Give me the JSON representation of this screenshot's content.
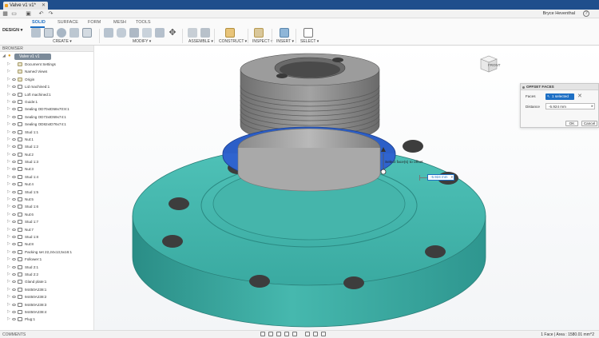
{
  "window": {
    "tab_title": "Valve v1 v1*"
  },
  "quick_access": {
    "user_name": "Bryce Heventhal"
  },
  "ribbon": {
    "workspace": "DESIGN ▾",
    "tabs": [
      "SOLID",
      "SURFACE",
      "FORM",
      "MESH",
      "TOOLS"
    ],
    "active_tab": "SOLID",
    "groups": [
      "CREATE ▾",
      "MODIFY ▾",
      "ASSEMBLE ▾",
      "CONSTRUCT ▾",
      "INSPECT ▾",
      "INSERT ▾",
      "SELECT ▾"
    ]
  },
  "browser": {
    "header": "BROWSER",
    "root_label": "Valve v1 v1",
    "items": [
      "Document Settings",
      "Named Views",
      "Origin",
      "Lid machined:1",
      "Loft machined:1",
      "Guide:1",
      "Sealing OD70xID58x70:8:1",
      "Sealing OD73xID59x74:1",
      "Sealing OD82xID76x74:1",
      "Stud 1:1",
      "Nut:1",
      "Stud 1:2",
      "Nut:2",
      "Stud 1:3",
      "Nut:3",
      "Stud 1:4",
      "Nut:4",
      "Stud 1:5",
      "Nut:5",
      "Stud 1:6",
      "Nut:6",
      "Stud 1:7",
      "Nut:7",
      "Stud 1:8",
      "Nut:8",
      "Packing set 22,24x13,5x16:1",
      "Follower:1",
      "Stud 2:1",
      "Stud 2:2",
      "Gland plate:1",
      "94450A238:1",
      "94450A238:2",
      "94450A238:3",
      "94450A238:4",
      "Plug:1"
    ]
  },
  "dialog": {
    "title": "OFFSET FACES",
    "faces_label": "Faces",
    "faces_value": "1 selected",
    "distance_label": "Distance",
    "distance_value": "-5.924 mm",
    "ok_label": "OK",
    "cancel_label": "Cancel"
  },
  "viewport": {
    "tooltip": "Select face(s) to offset",
    "dimension_value": "-5.924 mm",
    "viewcube_label": "FRONT"
  },
  "status": {
    "comments_label": "COMMENTS",
    "selection_info": "1 Face | Area : 1580.01 mm^2"
  },
  "colors": {
    "model_teal": "#3fb0a8",
    "selection_blue": "#2c5fc8",
    "accent": "#1d6fc4",
    "titlebar": "#1f4e8c"
  }
}
